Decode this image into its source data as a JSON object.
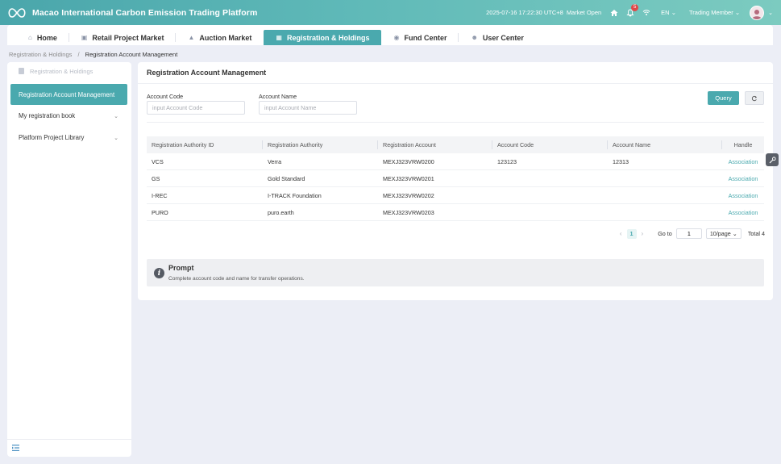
{
  "header": {
    "title": "Macao International Carbon Emission Trading Platform",
    "datetime": "2025-07-16 17:22:30 UTC+8",
    "market_status": "Market Open",
    "notification_count": "5",
    "language": "EN",
    "member": "Trading Member",
    "icons": [
      "logo-icon",
      "home-icon",
      "bell-icon",
      "wifi-icon",
      "avatar",
      "chevron-down-icon"
    ]
  },
  "nav": {
    "tabs": [
      {
        "label": "Home",
        "icon": "home-icon"
      },
      {
        "label": "Retail Project Market",
        "icon": "store-icon"
      },
      {
        "label": "Auction Market",
        "icon": "gavel-icon"
      },
      {
        "label": "Registration & Holdings",
        "icon": "document-icon",
        "active": true
      },
      {
        "label": "Fund Center",
        "icon": "fund-icon"
      },
      {
        "label": "User Center",
        "icon": "user-icon"
      }
    ]
  },
  "breadcrumb": {
    "parent": "Registration & Holdings",
    "separator": "/",
    "current": "Registration Account Management"
  },
  "sidebar": {
    "header": "Registration & Holdings",
    "items": [
      {
        "label": "Registration Account Management",
        "active": true
      },
      {
        "label": "My registration book"
      },
      {
        "label": "Platform Project Library"
      }
    ]
  },
  "main": {
    "title": "Registration Account Management",
    "filters": {
      "account_code": {
        "label": "Account Code",
        "placeholder": "input Account Code",
        "value": ""
      },
      "account_name": {
        "label": "Account Name",
        "placeholder": "input Account Name",
        "value": ""
      }
    },
    "query_label": "Query",
    "table": {
      "columns": [
        "Registration Authority ID",
        "Registration Authority",
        "Registration Account",
        "Account Code",
        "Account Name",
        "Handle"
      ],
      "rows": [
        {
          "id": "VCS",
          "authority": "Verra",
          "account": "MEXJ323VRW0200",
          "code": "123123",
          "name": "12313",
          "handle": "Association"
        },
        {
          "id": "GS",
          "authority": "Gold Standard",
          "account": "MEXJ323VRW0201",
          "code": "",
          "name": "",
          "handle": "Association"
        },
        {
          "id": "I-REC",
          "authority": "I-TRACK Foundation",
          "account": "MEXJ323VRW0202",
          "code": "",
          "name": "",
          "handle": "Association"
        },
        {
          "id": "PURO",
          "authority": "puro.earth",
          "account": "MEXJ323VRW0203",
          "code": "",
          "name": "",
          "handle": "Association"
        }
      ]
    },
    "pagination": {
      "current_page": "1",
      "goto_label": "Go to",
      "goto_value": "1",
      "page_size": "10/page",
      "total": "Total 4"
    },
    "prompt": {
      "title": "Prompt",
      "text": "Complete account code and name for transfer operations."
    }
  },
  "colors": {
    "accent": "#4aa9ae",
    "header_gradient_start": "#4aa6ab",
    "header_gradient_end": "#7ccbc0",
    "badge": "#e04848",
    "background": "#eceef6"
  }
}
